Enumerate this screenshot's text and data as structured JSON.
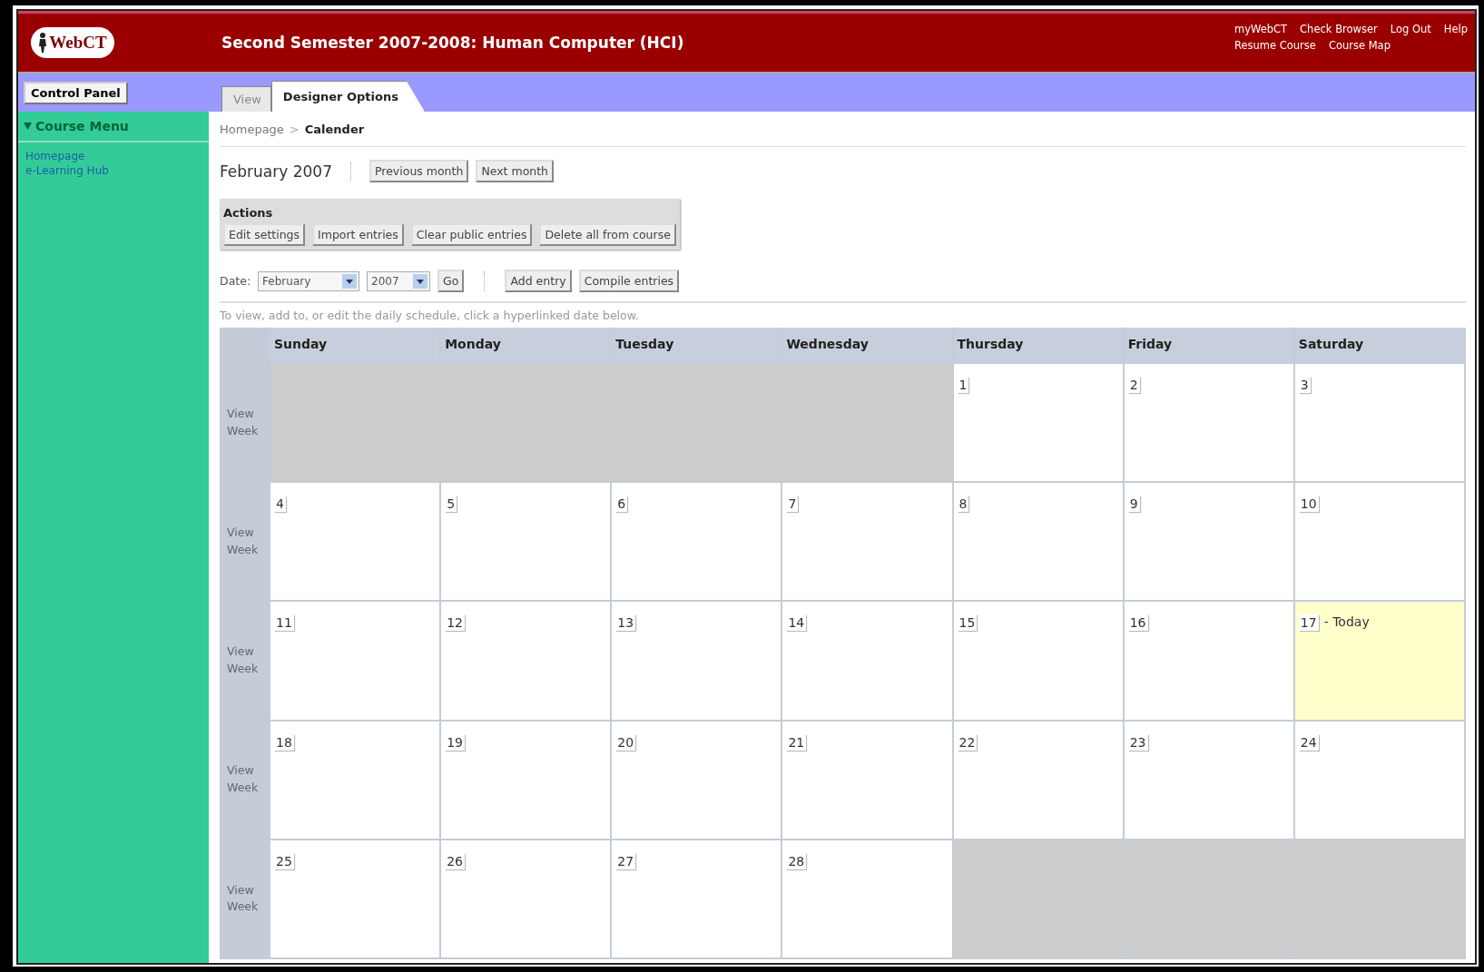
{
  "header": {
    "logo": "WebCT",
    "title": "Second Semester 2007-2008: Human Computer  (HCI)",
    "links_top": [
      "myWebCT",
      "Check Browser",
      "Log Out",
      "Help"
    ],
    "links_bottom": [
      "Resume Course",
      "Course Map"
    ]
  },
  "control_panel": "Control Panel",
  "tabs": [
    {
      "label": "View",
      "selected": false
    },
    {
      "label": "Designer Options",
      "selected": true
    }
  ],
  "sidebar": {
    "heading": "Course Menu",
    "expanded": true,
    "items": [
      "Homepage",
      "e-Learning Hub"
    ]
  },
  "breadcrumb": {
    "link": "Homepage",
    "separator": ">",
    "current": "Calender"
  },
  "month": {
    "title": "February 2007",
    "buttons": [
      "Previous month",
      "Next month"
    ]
  },
  "actions": {
    "title": "Actions",
    "buttons": [
      "Edit settings",
      "Import entries",
      "Clear public entries",
      "Delete all from course"
    ]
  },
  "date_picker": {
    "label": "Date:",
    "month": "February",
    "year": "2007",
    "go": "Go",
    "buttons": [
      "Add entry",
      "Compile entries"
    ]
  },
  "instructions": "To view, add to, or edit the daily schedule, click a hyperlinked date below.",
  "calendar": {
    "columns": [
      "Sunday",
      "Monday",
      "Tuesday",
      "Wednesday",
      "Thursday",
      "Friday",
      "Saturday"
    ],
    "weeks": [
      {
        "link": "View Week",
        "days": [
          {
            "in_month": false
          },
          {
            "in_month": false
          },
          {
            "in_month": false
          },
          {
            "in_month": false
          },
          {
            "in_month": true,
            "date": "1",
            "today": false
          },
          {
            "in_month": true,
            "date": "2",
            "today": false
          },
          {
            "in_month": true,
            "date": "3",
            "today": false
          }
        ]
      },
      {
        "link": "View Week",
        "days": [
          {
            "in_month": true,
            "date": "4",
            "today": false
          },
          {
            "in_month": true,
            "date": "5",
            "today": false
          },
          {
            "in_month": true,
            "date": "6",
            "today": false
          },
          {
            "in_month": true,
            "date": "7",
            "today": false
          },
          {
            "in_month": true,
            "date": "8",
            "today": false
          },
          {
            "in_month": true,
            "date": "9",
            "today": false
          },
          {
            "in_month": true,
            "date": "10",
            "today": false
          }
        ]
      },
      {
        "link": "View Week",
        "days": [
          {
            "in_month": true,
            "date": "11",
            "today": false
          },
          {
            "in_month": true,
            "date": "12",
            "today": false
          },
          {
            "in_month": true,
            "date": "13",
            "today": false
          },
          {
            "in_month": true,
            "date": "14",
            "today": false
          },
          {
            "in_month": true,
            "date": "15",
            "today": false
          },
          {
            "in_month": true,
            "date": "16",
            "today": false
          },
          {
            "in_month": true,
            "date": "17",
            "today": true,
            "note": "- Today"
          }
        ]
      },
      {
        "link": "View Week",
        "days": [
          {
            "in_month": true,
            "date": "18",
            "today": false
          },
          {
            "in_month": true,
            "date": "19",
            "today": false
          },
          {
            "in_month": true,
            "date": "20",
            "today": false
          },
          {
            "in_month": true,
            "date": "21",
            "today": false
          },
          {
            "in_month": true,
            "date": "22",
            "today": false
          },
          {
            "in_month": true,
            "date": "23",
            "today": false
          },
          {
            "in_month": true,
            "date": "24",
            "today": false
          }
        ]
      },
      {
        "link": "View Week",
        "days": [
          {
            "in_month": true,
            "date": "25",
            "today": false
          },
          {
            "in_month": true,
            "date": "26",
            "today": false
          },
          {
            "in_month": true,
            "date": "27",
            "today": false
          },
          {
            "in_month": true,
            "date": "28",
            "today": false
          },
          {
            "in_month": false
          },
          {
            "in_month": false
          },
          {
            "in_month": false
          }
        ]
      }
    ]
  }
}
